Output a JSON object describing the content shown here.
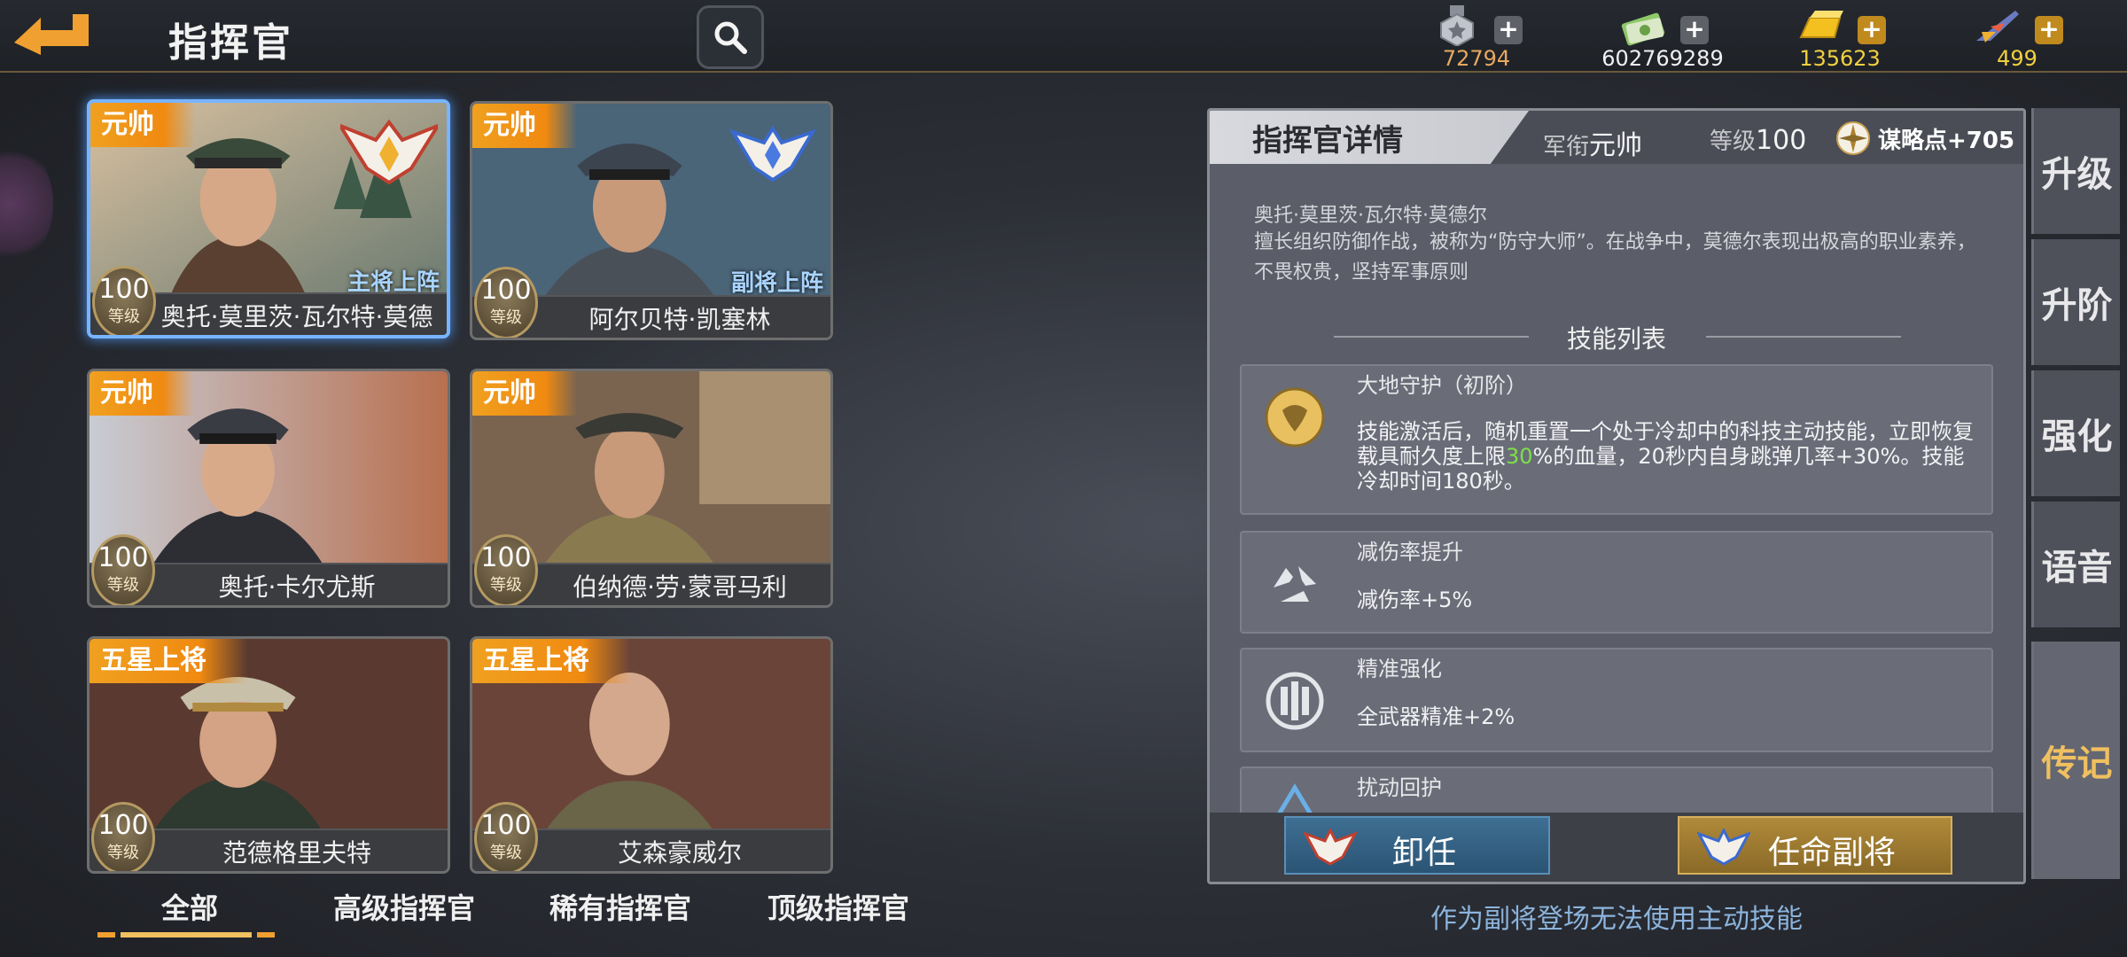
{
  "header": {
    "title": "指挥官",
    "back_icon": "back-arrow-icon",
    "search_icon": "magnifier-icon"
  },
  "resources": [
    {
      "name": "medal",
      "value": "72794",
      "color": "#e8a860",
      "plus": "+"
    },
    {
      "name": "cash",
      "value": "602769289",
      "color": "#f0f0f0",
      "plus": "+"
    },
    {
      "name": "gold",
      "value": "135623",
      "color": "#f0d040",
      "plus": "+"
    },
    {
      "name": "fighter",
      "value": "499",
      "color": "#f0d040",
      "plus": "+"
    }
  ],
  "cards": [
    {
      "rank": "元帅",
      "name": "奥托·莫里茨·瓦尔特·莫德尔",
      "level": "100",
      "level_label": "等级",
      "role": "主将上阵",
      "selected": true
    },
    {
      "rank": "元帅",
      "name": "阿尔贝特·凯塞林",
      "level": "100",
      "level_label": "等级",
      "role": "副将上阵"
    },
    {
      "rank": "元帅",
      "name": "奥托·卡尔尤斯",
      "level": "100",
      "level_label": "等级"
    },
    {
      "rank": "元帅",
      "name": "伯纳德·劳·蒙哥马利",
      "level": "100",
      "level_label": "等级"
    },
    {
      "rank": "五星上将",
      "name": "范德格里夫特",
      "level": "100",
      "level_label": "等级"
    },
    {
      "rank": "五星上将",
      "name": "艾森豪威尔",
      "level": "100",
      "level_label": "等级"
    }
  ],
  "filters": [
    "全部",
    "高级指挥官",
    "稀有指挥官",
    "顶级指挥官"
  ],
  "panel": {
    "title": "指挥官详情",
    "rank_label": "军衔",
    "rank_value": "元帅",
    "level_label": "等级",
    "level_value": "100",
    "strategy": "谋略点+705",
    "bio_name": "奥托·莫里茨·瓦尔特·莫德尔",
    "bio_desc": "擅长组织防御作战，被称为“防守大师”。在战争中，莫德尔表现出极高的职业素养，不畏权贵，坚持军事原则",
    "skills_heading": "技能列表",
    "skills": [
      {
        "name": "大地守护（初阶）",
        "desc_pre": "技能激活后，随机重置一个处于冷却中的科技主动技能，立即恢复载具耐久度上限",
        "desc_hl": "30",
        "desc_post": "%的血量，20秒内自身跳弹几率+30%。技能冷却时间180秒。",
        "icon": "earth-guard-icon"
      },
      {
        "name": "减伤率提升",
        "desc": "减伤率+5%",
        "icon": "damage-reduction-icon"
      },
      {
        "name": "精准强化",
        "desc": "全武器精准+2%",
        "icon": "precision-icon"
      },
      {
        "name": "扰动回护",
        "icon": "disturbance-icon"
      }
    ],
    "dismiss": "卸任",
    "appoint": "任命副将"
  },
  "sub_note": "作为副将登场无法使用主动技能",
  "side_tabs": [
    "升级",
    "升阶",
    "强化",
    "语音",
    "传记"
  ]
}
